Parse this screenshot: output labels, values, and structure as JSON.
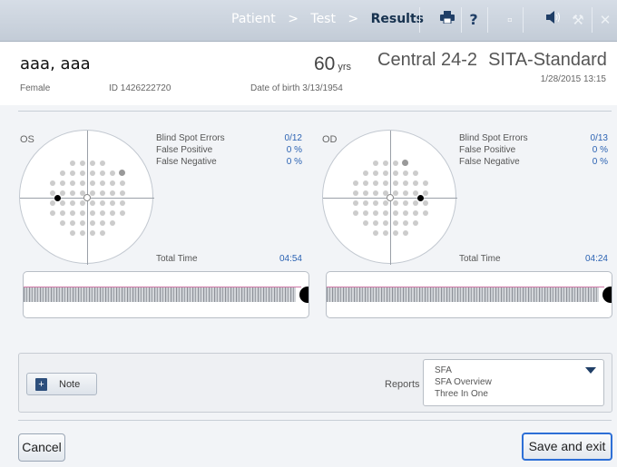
{
  "nav": {
    "crumbs": [
      "Patient",
      "Test",
      "Results"
    ],
    "separator": ">",
    "icons": [
      "printer-icon",
      "help-icon",
      "small-dot-icon",
      "speaker-icon",
      "wrench-icon",
      "close-icon"
    ]
  },
  "patient": {
    "name": "aaa, aaa",
    "sex": "Female",
    "id_label": "ID 1426222720",
    "age": "60",
    "age_unit": "yrs",
    "dob_label": "Date of birth",
    "dob": "3/13/1954"
  },
  "test": {
    "program": "Central 24-2",
    "strategy": "SITA-Standard",
    "datetime": "1/28/2015 13:15"
  },
  "eyes": {
    "left": {
      "label": "OS",
      "blind_spot_label": "Blind Spot Errors",
      "blind_spot_value": "0/12",
      "false_pos_label": "False Positive",
      "false_pos_value": "0 %",
      "false_neg_label": "False Negative",
      "false_neg_value": "0 %",
      "total_time_label": "Total Time",
      "total_time_value": "04:54"
    },
    "right": {
      "label": "OD",
      "blind_spot_label": "Blind Spot Errors",
      "blind_spot_value": "0/13",
      "false_pos_label": "False Positive",
      "false_pos_value": "0 %",
      "false_neg_label": "False Negative",
      "false_neg_value": "0 %",
      "total_time_label": "Total Time",
      "total_time_value": "04:24"
    }
  },
  "note_button": "Note",
  "reports": {
    "label": "Reports",
    "options": [
      "SFA",
      "SFA Overview",
      "Three In One"
    ]
  },
  "footer": {
    "cancel": "Cancel",
    "save": "Save and exit"
  }
}
